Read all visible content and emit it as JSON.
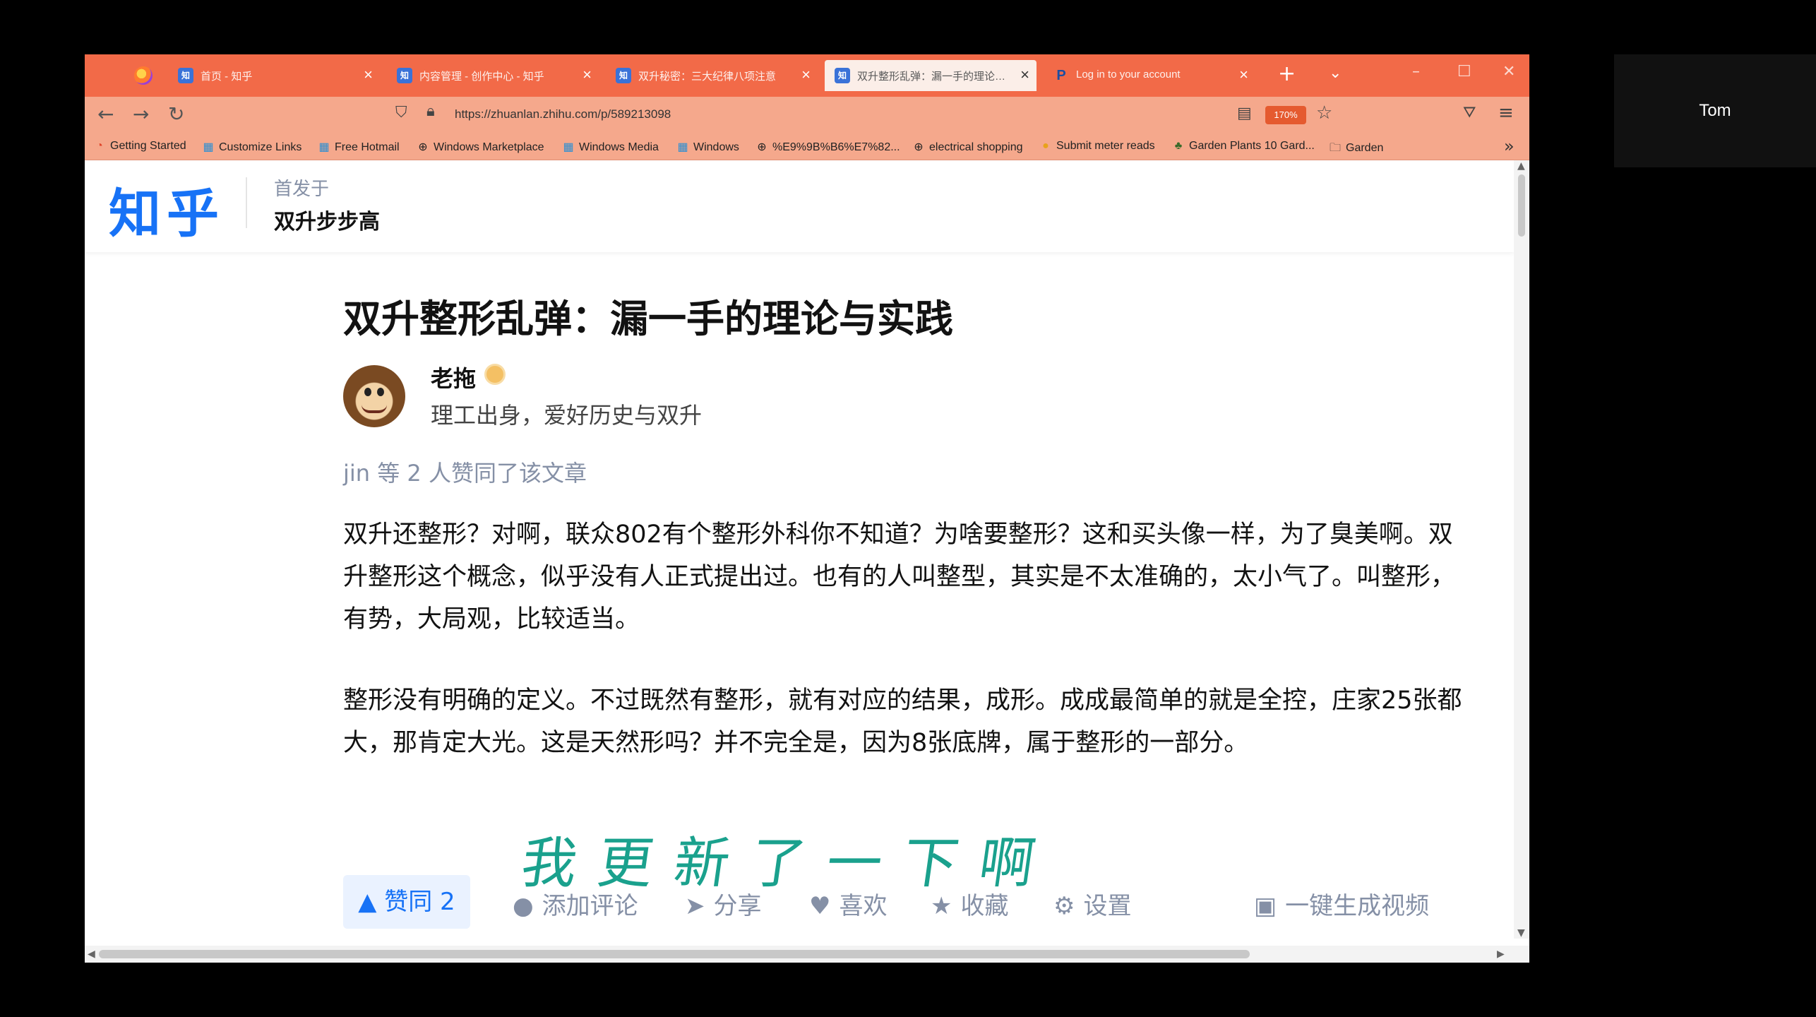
{
  "participant": {
    "name": "Tom"
  },
  "browser": {
    "tabs": [
      {
        "label": "首页 - 知乎",
        "icon": "zhihu-favicon"
      },
      {
        "label": "内容管理 - 创作中心 - 知乎",
        "icon": "zhihu-favicon"
      },
      {
        "label": "双升秘密：三大纪律八项注意",
        "icon": "zhihu-favicon"
      },
      {
        "label": "双升整形乱弹：漏一手的理论与实践",
        "icon": "zhihu-favicon",
        "active": true
      },
      {
        "label": "Log in to your account",
        "icon": "paypal-favicon"
      }
    ],
    "url": "https://zhuanlan.zhihu.com/p/589213098",
    "zoom": "170%",
    "bookmarks": [
      "Getting Started",
      "Customize Links",
      "Free Hotmail",
      "Windows Marketplace",
      "Windows Media",
      "Windows",
      "%E9%9B%B6%E7%82...",
      "electrical shopping",
      "Submit meter reads",
      "Garden Plants 10 Gard...",
      "Garden"
    ]
  },
  "zhihu": {
    "logo": "知乎",
    "column_prefix": "首发于",
    "column_name": "双升步步高"
  },
  "article": {
    "title": "双升整形乱弹：漏一手的理论与实践",
    "author": "老拖",
    "bio": "理工出身，爱好历史与双升",
    "likers": "jin 等 2 人赞同了该文章",
    "paragraphs": [
      "双升还整形？对啊，联众802有个整形外科你不知道？为啥要整形？这和买头像一样，为了臭美啊。双升整形这个概念，似乎没有人正式提出过。也有的人叫整型，其实是不太准确的，太小气了。叫整形，有势，大局观，比较适当。",
      "整形没有明确的定义。不过既然有整形，就有对应的结果，成形。成成最简单的就是全控，庄家25张都大，那肯定大光。这是天然形吗？并不完全是，因为8张底牌，属于整形的一部分。"
    ]
  },
  "actions": {
    "vote": "▲ 赞同 2",
    "comment": "添加评论",
    "share": "分享",
    "like": "喜欢",
    "collect": "收藏",
    "settings": "设置",
    "video": "一键生成视频"
  },
  "overlay": {
    "caption": "我更新了一下啊"
  }
}
